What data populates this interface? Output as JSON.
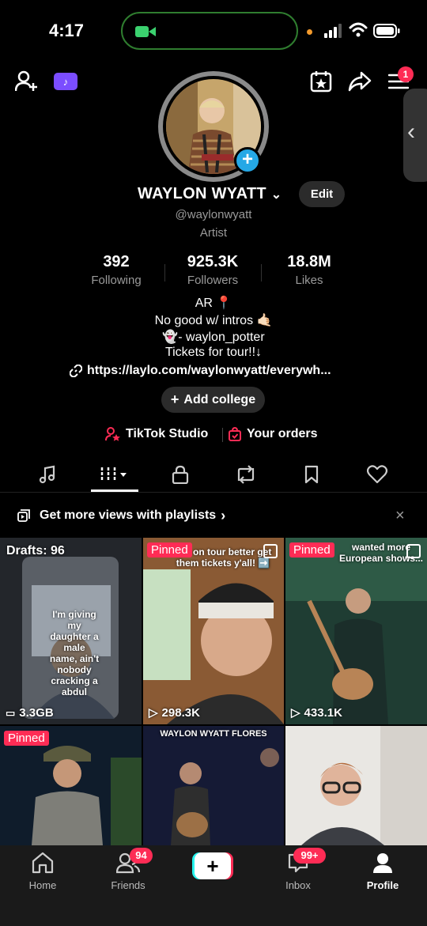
{
  "status_bar": {
    "time": "4:17"
  },
  "header": {
    "notification_count": "1"
  },
  "profile": {
    "name": "WAYLON WYATT",
    "edit_label": "Edit",
    "handle": "@waylonwyatt",
    "category": "Artist",
    "stats": [
      {
        "value": "392",
        "label": "Following"
      },
      {
        "value": "925.3K",
        "label": "Followers"
      },
      {
        "value": "18.8M",
        "label": "Likes"
      }
    ],
    "bio_lines": [
      "AR 📍",
      "No good w/ intros 🤙🏻",
      "👻- waylon_potter",
      "Tickets for tour!!↓"
    ],
    "link": "https://laylo.com/waylonwyatt/everywh...",
    "add_college": "Add college",
    "shortcuts": [
      "TikTok Studio",
      "Your orders"
    ]
  },
  "banner": {
    "text": "Get more views with playlists"
  },
  "grid": {
    "drafts_label": "Drafts: 96",
    "pinned_label": "Pinned",
    "tiles": [
      {
        "views": "3.3GB",
        "overlay": "I'm giving my daughter a male name, ain't nobody cracking a abdul"
      },
      {
        "views": "298.3K",
        "overlay": "ack on tour better get them tickets y'all! ➡️"
      },
      {
        "views": "433.1K",
        "overlay": "wanted more European shows..."
      },
      {
        "views": "",
        "overlay": ""
      },
      {
        "views": "",
        "overlay": "WAYLON WYATT FLORES"
      },
      {
        "views": "",
        "overlay": ""
      }
    ]
  },
  "bottom_nav": {
    "items": [
      "Home",
      "Friends",
      "",
      "Inbox",
      "Profile"
    ],
    "friends_badge": "94",
    "inbox_badge": "99+"
  },
  "colors": {
    "accent": "#fe2c55",
    "blue": "#25a8e6",
    "bg": "#000000"
  }
}
